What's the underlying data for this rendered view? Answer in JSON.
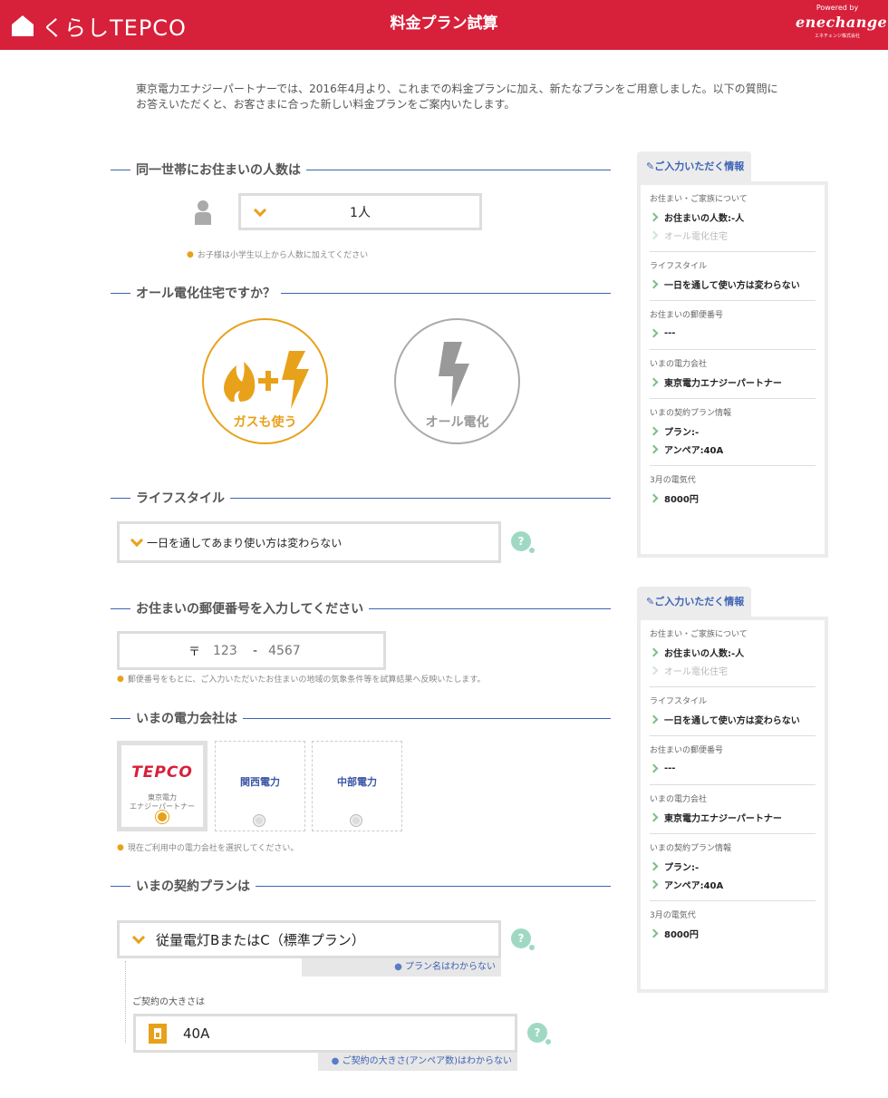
{
  "header": {
    "logo_text": "くらしTEPCO",
    "title": "料金プラン試算",
    "powered_by": "Powered by",
    "partner_logo": "enechange",
    "partner_company": "エネチェンジ株式会社"
  },
  "intro": "東京電力エナジーパートナーでは、2016年4月より、これまでの料金プランに加え、新たなプランをご用意しました。以下の質問にお答えいただくと、お客さまに合った新しい料金プランをご案内いたします。",
  "household": {
    "heading": "同一世帯にお住まいの人数は",
    "value": "1人",
    "hint": "お子様は小学生以上から人数に加えてください"
  },
  "allelectric": {
    "heading": "オール電化住宅ですか？",
    "option_gas": "ガスも使う",
    "option_all": "オール電化",
    "selected": "ガスも使う"
  },
  "lifestyle": {
    "heading": "ライフスタイル",
    "value": "一日を通してあまり使い方は変わらない",
    "help": "?"
  },
  "postal": {
    "heading": "お住まいの郵便番号を入力してください",
    "mark": "〒",
    "placeholder1": "123",
    "separator": "-",
    "placeholder2": "4567",
    "hint": "郵便番号をもとに、ご入力いただいたお住まいの地域の気象条件等を試算結果へ反映いたします。"
  },
  "company": {
    "heading": "いまの電力会社は",
    "cards": [
      {
        "logo": "TEPCO",
        "label": "東京電力\nエナジーパートナー",
        "selected": true
      },
      {
        "logo": "関西電力",
        "label": "",
        "selected": false
      },
      {
        "logo": "中部電力",
        "label": "",
        "selected": false
      }
    ],
    "hint": "現在ご利用中の電力会社を選択してください。"
  },
  "plan": {
    "heading": "いまの契約プランは",
    "value": "従量電灯BまたはC（標準プラン）",
    "help": "?",
    "unknown": "プラン名はわからない",
    "size_label": "ご契約の大きさは",
    "size_value": "40A",
    "size_unknown": "ご契約の大きさ(アンペア数)はわからない"
  },
  "panel": {
    "tab": "ご入力いただく情報",
    "groups": [
      {
        "title": "お住まい・ご家族について",
        "items": [
          {
            "text": "お住まいの人数:-人",
            "dim": false
          },
          {
            "text": "オール電化住宅",
            "dim": true
          }
        ]
      },
      {
        "title": "ライフスタイル",
        "items": [
          {
            "text": "一日を通して使い方は変わらない",
            "dim": false
          }
        ]
      },
      {
        "title": "お住まいの郵便番号",
        "items": [
          {
            "text": "---",
            "dim": false
          }
        ]
      },
      {
        "title": "いまの電力会社",
        "items": [
          {
            "text": "東京電力エナジーパートナー",
            "dim": false
          }
        ]
      },
      {
        "title": "いまの契約プラン情報",
        "items": [
          {
            "text": "プラン:-",
            "dim": false
          },
          {
            "text": "アンペア:40A",
            "dim": false
          }
        ]
      },
      {
        "title": "3月の電気代",
        "items": [
          {
            "text": "8000円",
            "dim": false
          }
        ]
      }
    ]
  },
  "colors": {
    "brand_red": "#d7203a",
    "accent_orange": "#e8a11a",
    "link_blue": "#3d63b5",
    "help_green": "#9fd9c3"
  }
}
